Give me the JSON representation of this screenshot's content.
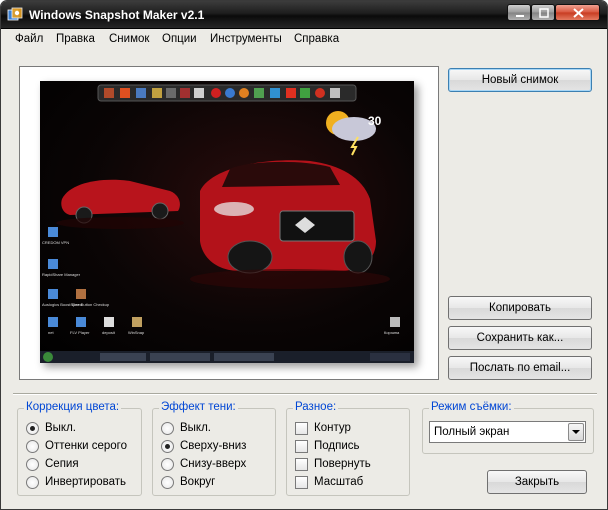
{
  "window": {
    "title": "Windows Snapshot Maker v2.1"
  },
  "menu": [
    "Файл",
    "Правка",
    "Снимок",
    "Опции",
    "Инструменты",
    "Справка"
  ],
  "buttons": {
    "new_snapshot": "Новый снимок",
    "copy": "Копировать",
    "save_as": "Сохранить как...",
    "send_email": "Послать по email...",
    "close": "Закрыть"
  },
  "groups": {
    "color_correction": {
      "title": "Коррекция цвета:",
      "options": [
        "Выкл.",
        "Оттенки серого",
        "Сепия",
        "Инвертировать"
      ],
      "selected": 0
    },
    "shadow_effect": {
      "title": "Эффект тени:",
      "options": [
        "Выкл.",
        "Сверху-вниз",
        "Снизу-вверх",
        "Вокруг"
      ],
      "selected": 1
    },
    "misc": {
      "title": "Разное:",
      "options": [
        "Контур",
        "Подпись",
        "Повернуть",
        "Масштаб"
      ],
      "checked": [
        false,
        false,
        false,
        false
      ]
    },
    "capture_mode": {
      "title": "Режим съёмки:",
      "selected_value": "Полный экран"
    }
  },
  "preview": {
    "weather_temp": "30",
    "desktop_icons": [
      "CREDOM VPN",
      "RapidShare Manager",
      "Auslogics BoostSpeed",
      "One Button Checkup",
      "net",
      "FLV Player",
      "deposit",
      "WinSnap",
      "Корзина"
    ]
  }
}
